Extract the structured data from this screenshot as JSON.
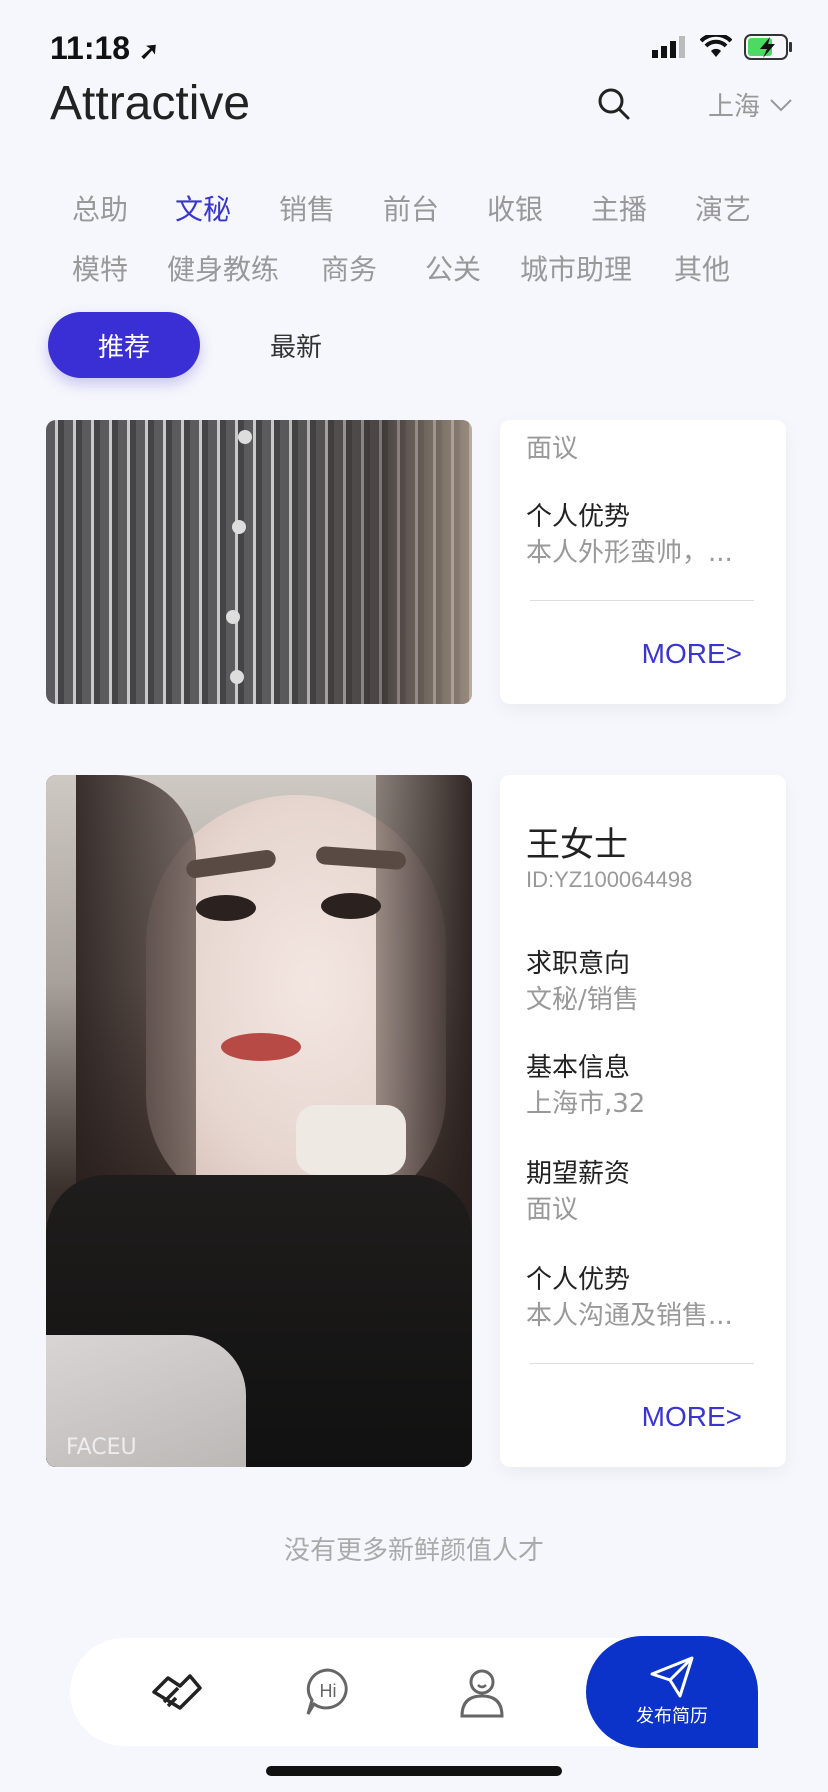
{
  "status": {
    "time": "11:18"
  },
  "header": {
    "title": "Attractive",
    "city": "上海"
  },
  "categories": [
    [
      "总助",
      "文秘",
      "销售",
      "前台",
      "收银",
      "主播",
      "演艺"
    ],
    [
      "模特",
      "健身教练",
      "商务",
      "公关",
      "城市助理",
      "其他"
    ]
  ],
  "active_category": "文秘",
  "filters": {
    "recommended": "推荐",
    "latest": "最新"
  },
  "cards": [
    {
      "fields": [
        {
          "value": "面议"
        },
        {
          "label": "个人优势",
          "value": "本人外形蛮帅，..."
        }
      ],
      "more": "MORE>"
    },
    {
      "name": "王女士",
      "id": "ID:YZ100064498",
      "fields": [
        {
          "label": "求职意向",
          "value": "文秘/销售"
        },
        {
          "label": "基本信息",
          "value": "上海市,32"
        },
        {
          "label": "期望薪资",
          "value": "面议"
        },
        {
          "label": "个人优势",
          "value": "本人沟通及销售..."
        }
      ],
      "more": "MORE>",
      "photo_watermark": "FACEU"
    }
  ],
  "footer_note": "没有更多新鲜颜值人才",
  "nav": {
    "publish": "发布简历",
    "hi": "Hi"
  },
  "colors": {
    "accent": "#3a35d0",
    "pill": "#3a2fd4",
    "publish": "#0b33c9",
    "background": "#f6f7fc"
  }
}
